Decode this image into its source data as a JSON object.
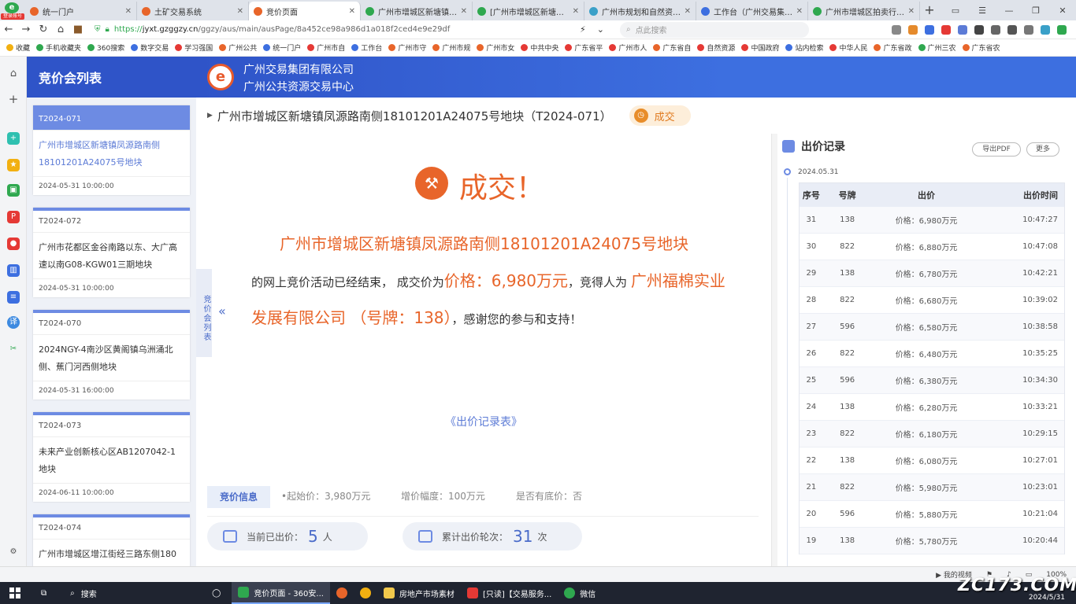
{
  "browser": {
    "login_badge": "登录账号",
    "tabs": [
      {
        "title": "统一门户",
        "color": "#e8652a",
        "active": false
      },
      {
        "title": "土矿交易系统",
        "color": "#e8652a",
        "active": false
      },
      {
        "title": "竞价页面",
        "color": "#e8652a",
        "active": true
      },
      {
        "title": "广州市增城区新塘镇凤源",
        "color": "#2fa84f",
        "active": false
      },
      {
        "title": "[广州市增城区新塘镇凤",
        "color": "#2fa84f",
        "active": false
      },
      {
        "title": "广州市规划和自然资源局",
        "color": "#3aa0c8",
        "active": false
      },
      {
        "title": "工作台（广州交易集团有",
        "color": "#3d6fe0",
        "active": false
      },
      {
        "title": "广州市增城区拍卖行有限",
        "color": "#2fa84f",
        "active": false
      }
    ],
    "url_scheme": "https://",
    "url_host": "jyxt.gzggzy.cn",
    "url_path": "/ggzy/aus/main/ausPage/8a452ce98a986d1a018f2ced4e9e29df",
    "search_placeholder": "点此搜索",
    "bookmarks": [
      "收藏",
      "手机收藏夹",
      "360搜索",
      "数字交易",
      "学习强国",
      "广州公共",
      "统一门户",
      "广州市自",
      "工作台",
      "广州市守",
      "广州市规",
      "广州市女",
      "中共中央",
      "广东省平",
      "广州市人",
      "广东省自",
      "自然资源",
      "中国政府",
      "站内检索",
      "中华人民",
      "广东省政",
      "广州三农",
      "广东省农"
    ]
  },
  "site": {
    "list_title": "竞价会列表",
    "org_line1": "广州交易集团有限公司",
    "org_line2": "广州公共资源交易中心",
    "logo_letter": "e"
  },
  "auction_list": [
    {
      "code": "T2024-071",
      "name": "广州市增城区新塘镇凤源路南侧18101201A24075号地块",
      "time": "2024-05-31 10:00:00",
      "active": true
    },
    {
      "code": "T2024-072",
      "name": "广州市花都区金谷南路以东、大广高速以南G08-KGW01三期地块",
      "time": "2024-05-31 10:00:00",
      "active": false
    },
    {
      "code": "T2024-070",
      "name": "2024NGY-4南沙区黄阁镇乌洲涌北侧、蕉门河西侧地块",
      "time": "2024-05-31 16:00:00",
      "active": false
    },
    {
      "code": "T2024-073",
      "name": "未来产业创新核心区AB1207042-1地块",
      "time": "2024-06-11 10:00:00",
      "active": false
    },
    {
      "code": "T2024-074",
      "name": "广州市增城区增江街经三路东侧180",
      "time": "",
      "active": false
    }
  ],
  "detail": {
    "title": "广州市增城区新塘镇凤源路南侧18101201A24075号地块（T2024-071）",
    "status_badge": "成交",
    "drawer_label": "竞价会列表",
    "result_heading": "成交！",
    "msg_parcel": "广州市增城区新塘镇凤源路南侧18101201A24075号地块",
    "msg_mid1": "的网上竞价活动已经结束， 成交价为",
    "msg_price": "价格：6,980万元",
    "msg_mid2": "，竞得人为",
    "msg_winner": "广州福棉实业发展有限公司 （号牌：138）",
    "msg_end": "，感谢您的参与和支持！",
    "record_link": "《出价记录表》",
    "info_tab": "竞价信息",
    "start_price": "•起始价：3,980万元",
    "increment": "增价幅度：100万元",
    "reserve": "是否有底价：否",
    "bidders_label": "当前已出价：",
    "bidders_count": "5",
    "bidders_unit": "人",
    "rounds_label": "累计出价轮次：",
    "rounds_count": "31",
    "rounds_unit": "次"
  },
  "bid_record": {
    "title": "出价记录",
    "export_btn": "导出PDF",
    "more_btn": "更多",
    "date": "2024.05.31",
    "headers": [
      "序号",
      "号牌",
      "出价",
      "出价时间"
    ],
    "rows": [
      [
        "31",
        "138",
        "价格：6,980万元",
        "10:47:27"
      ],
      [
        "30",
        "822",
        "价格：6,880万元",
        "10:47:08"
      ],
      [
        "29",
        "138",
        "价格：6,780万元",
        "10:42:21"
      ],
      [
        "28",
        "822",
        "价格：6,680万元",
        "10:39:02"
      ],
      [
        "27",
        "596",
        "价格：6,580万元",
        "10:38:58"
      ],
      [
        "26",
        "822",
        "价格：6,480万元",
        "10:35:25"
      ],
      [
        "25",
        "596",
        "价格：6,380万元",
        "10:34:30"
      ],
      [
        "24",
        "138",
        "价格：6,280万元",
        "10:33:21"
      ],
      [
        "23",
        "822",
        "价格：6,180万元",
        "10:29:15"
      ],
      [
        "22",
        "138",
        "价格：6,080万元",
        "10:27:01"
      ],
      [
        "21",
        "822",
        "价格：5,980万元",
        "10:23:01"
      ],
      [
        "20",
        "596",
        "价格：5,880万元",
        "10:21:04"
      ],
      [
        "19",
        "138",
        "价格：5,780万元",
        "10:20:44"
      ]
    ]
  },
  "statusbar": {
    "video": "我的视频",
    "zoom": "100%"
  },
  "taskbar": {
    "search": "搜索",
    "apps": [
      "竞价页面 - 360安...",
      "房地产市场素材",
      "[只读]【交易服务...",
      "微信"
    ],
    "time": "",
    "date": "2024/5/31"
  },
  "watermark": "ZC173.COM"
}
